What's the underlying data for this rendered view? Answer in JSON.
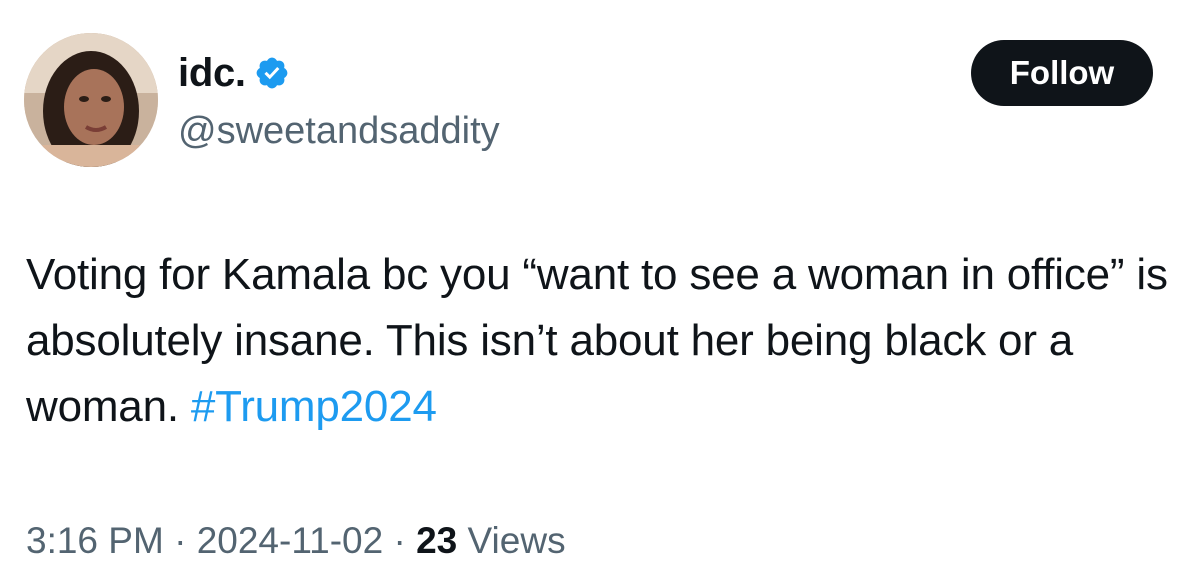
{
  "author": {
    "display_name": "idc.",
    "handle": "@sweetandsaddity",
    "verified": true,
    "avatar_icon": "profile-photo"
  },
  "follow_button": {
    "label": "Follow"
  },
  "tweet": {
    "text": "Voting for Kamala bc you “want to see a woman in office” is absolutely insane. This isn’t about her being black or a woman. ",
    "hashtag": "#Trump2024"
  },
  "meta": {
    "time": "3:16 PM",
    "separator": " · ",
    "date": "2024-11-02",
    "views_count": "23",
    "views_label": " Views"
  },
  "colors": {
    "accent": "#1d9bf0",
    "text_primary": "#0f1419",
    "text_secondary": "#536471",
    "button_bg": "#0f1419"
  }
}
